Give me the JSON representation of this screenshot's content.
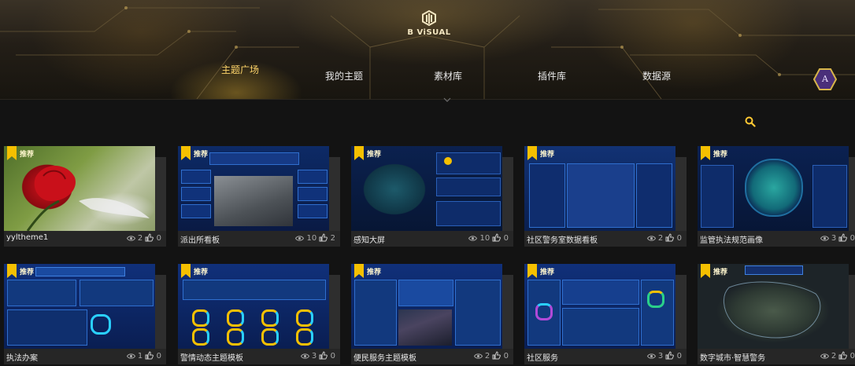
{
  "app": {
    "brand": "B ViSUAL"
  },
  "nav": {
    "tabs": [
      {
        "label": "主题广场",
        "active": true
      },
      {
        "label": "我的主题",
        "active": false
      },
      {
        "label": "素材库",
        "active": false
      },
      {
        "label": "插件库",
        "active": false
      },
      {
        "label": "数据源",
        "active": false
      }
    ],
    "avatar_letter": "A"
  },
  "colors": {
    "accent": "#ffcc44",
    "badge": "#f5c000",
    "thumb_bg": "#0a1c44"
  },
  "recommend_label": "推荐",
  "cards": [
    {
      "title": "yyltheme1",
      "views": "2",
      "likes": "0",
      "theme": "rose"
    },
    {
      "title": "派出所看板",
      "views": "10",
      "likes": "2",
      "theme": "city"
    },
    {
      "title": "感知大屏",
      "views": "10",
      "likes": "0",
      "theme": "map"
    },
    {
      "title": "社区警务室数据看板",
      "views": "2",
      "likes": "0",
      "theme": "dash"
    },
    {
      "title": "监管执法规范画像",
      "views": "3",
      "likes": "0",
      "theme": "province"
    },
    {
      "title": "执法办案",
      "views": "1",
      "likes": "0",
      "theme": "table"
    },
    {
      "title": "警情动态主题模板",
      "views": "3",
      "likes": "0",
      "theme": "rings"
    },
    {
      "title": "便民服务主题模板",
      "views": "2",
      "likes": "0",
      "theme": "photo"
    },
    {
      "title": "社区服务",
      "views": "3",
      "likes": "0",
      "theme": "charts"
    },
    {
      "title": "数字城市·智慧警务",
      "views": "2",
      "likes": "0",
      "theme": "satellite"
    }
  ]
}
